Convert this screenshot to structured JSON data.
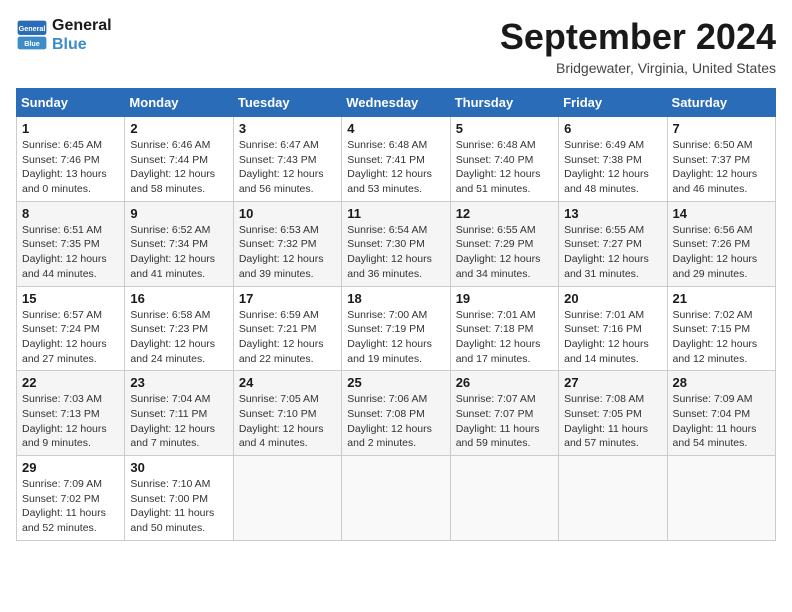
{
  "logo": {
    "text_general": "General",
    "text_blue": "Blue"
  },
  "header": {
    "month": "September 2024",
    "location": "Bridgewater, Virginia, United States"
  },
  "days_of_week": [
    "Sunday",
    "Monday",
    "Tuesday",
    "Wednesday",
    "Thursday",
    "Friday",
    "Saturday"
  ],
  "weeks": [
    [
      {
        "day": "1",
        "sunrise": "6:45 AM",
        "sunset": "7:46 PM",
        "daylight": "13 hours and 0 minutes."
      },
      {
        "day": "2",
        "sunrise": "6:46 AM",
        "sunset": "7:44 PM",
        "daylight": "12 hours and 58 minutes."
      },
      {
        "day": "3",
        "sunrise": "6:47 AM",
        "sunset": "7:43 PM",
        "daylight": "12 hours and 56 minutes."
      },
      {
        "day": "4",
        "sunrise": "6:48 AM",
        "sunset": "7:41 PM",
        "daylight": "12 hours and 53 minutes."
      },
      {
        "day": "5",
        "sunrise": "6:48 AM",
        "sunset": "7:40 PM",
        "daylight": "12 hours and 51 minutes."
      },
      {
        "day": "6",
        "sunrise": "6:49 AM",
        "sunset": "7:38 PM",
        "daylight": "12 hours and 48 minutes."
      },
      {
        "day": "7",
        "sunrise": "6:50 AM",
        "sunset": "7:37 PM",
        "daylight": "12 hours and 46 minutes."
      }
    ],
    [
      {
        "day": "8",
        "sunrise": "6:51 AM",
        "sunset": "7:35 PM",
        "daylight": "12 hours and 44 minutes."
      },
      {
        "day": "9",
        "sunrise": "6:52 AM",
        "sunset": "7:34 PM",
        "daylight": "12 hours and 41 minutes."
      },
      {
        "day": "10",
        "sunrise": "6:53 AM",
        "sunset": "7:32 PM",
        "daylight": "12 hours and 39 minutes."
      },
      {
        "day": "11",
        "sunrise": "6:54 AM",
        "sunset": "7:30 PM",
        "daylight": "12 hours and 36 minutes."
      },
      {
        "day": "12",
        "sunrise": "6:55 AM",
        "sunset": "7:29 PM",
        "daylight": "12 hours and 34 minutes."
      },
      {
        "day": "13",
        "sunrise": "6:55 AM",
        "sunset": "7:27 PM",
        "daylight": "12 hours and 31 minutes."
      },
      {
        "day": "14",
        "sunrise": "6:56 AM",
        "sunset": "7:26 PM",
        "daylight": "12 hours and 29 minutes."
      }
    ],
    [
      {
        "day": "15",
        "sunrise": "6:57 AM",
        "sunset": "7:24 PM",
        "daylight": "12 hours and 27 minutes."
      },
      {
        "day": "16",
        "sunrise": "6:58 AM",
        "sunset": "7:23 PM",
        "daylight": "12 hours and 24 minutes."
      },
      {
        "day": "17",
        "sunrise": "6:59 AM",
        "sunset": "7:21 PM",
        "daylight": "12 hours and 22 minutes."
      },
      {
        "day": "18",
        "sunrise": "7:00 AM",
        "sunset": "7:19 PM",
        "daylight": "12 hours and 19 minutes."
      },
      {
        "day": "19",
        "sunrise": "7:01 AM",
        "sunset": "7:18 PM",
        "daylight": "12 hours and 17 minutes."
      },
      {
        "day": "20",
        "sunrise": "7:01 AM",
        "sunset": "7:16 PM",
        "daylight": "12 hours and 14 minutes."
      },
      {
        "day": "21",
        "sunrise": "7:02 AM",
        "sunset": "7:15 PM",
        "daylight": "12 hours and 12 minutes."
      }
    ],
    [
      {
        "day": "22",
        "sunrise": "7:03 AM",
        "sunset": "7:13 PM",
        "daylight": "12 hours and 9 minutes."
      },
      {
        "day": "23",
        "sunrise": "7:04 AM",
        "sunset": "7:11 PM",
        "daylight": "12 hours and 7 minutes."
      },
      {
        "day": "24",
        "sunrise": "7:05 AM",
        "sunset": "7:10 PM",
        "daylight": "12 hours and 4 minutes."
      },
      {
        "day": "25",
        "sunrise": "7:06 AM",
        "sunset": "7:08 PM",
        "daylight": "12 hours and 2 minutes."
      },
      {
        "day": "26",
        "sunrise": "7:07 AM",
        "sunset": "7:07 PM",
        "daylight": "11 hours and 59 minutes."
      },
      {
        "day": "27",
        "sunrise": "7:08 AM",
        "sunset": "7:05 PM",
        "daylight": "11 hours and 57 minutes."
      },
      {
        "day": "28",
        "sunrise": "7:09 AM",
        "sunset": "7:04 PM",
        "daylight": "11 hours and 54 minutes."
      }
    ],
    [
      {
        "day": "29",
        "sunrise": "7:09 AM",
        "sunset": "7:02 PM",
        "daylight": "11 hours and 52 minutes."
      },
      {
        "day": "30",
        "sunrise": "7:10 AM",
        "sunset": "7:00 PM",
        "daylight": "11 hours and 50 minutes."
      },
      null,
      null,
      null,
      null,
      null
    ]
  ]
}
